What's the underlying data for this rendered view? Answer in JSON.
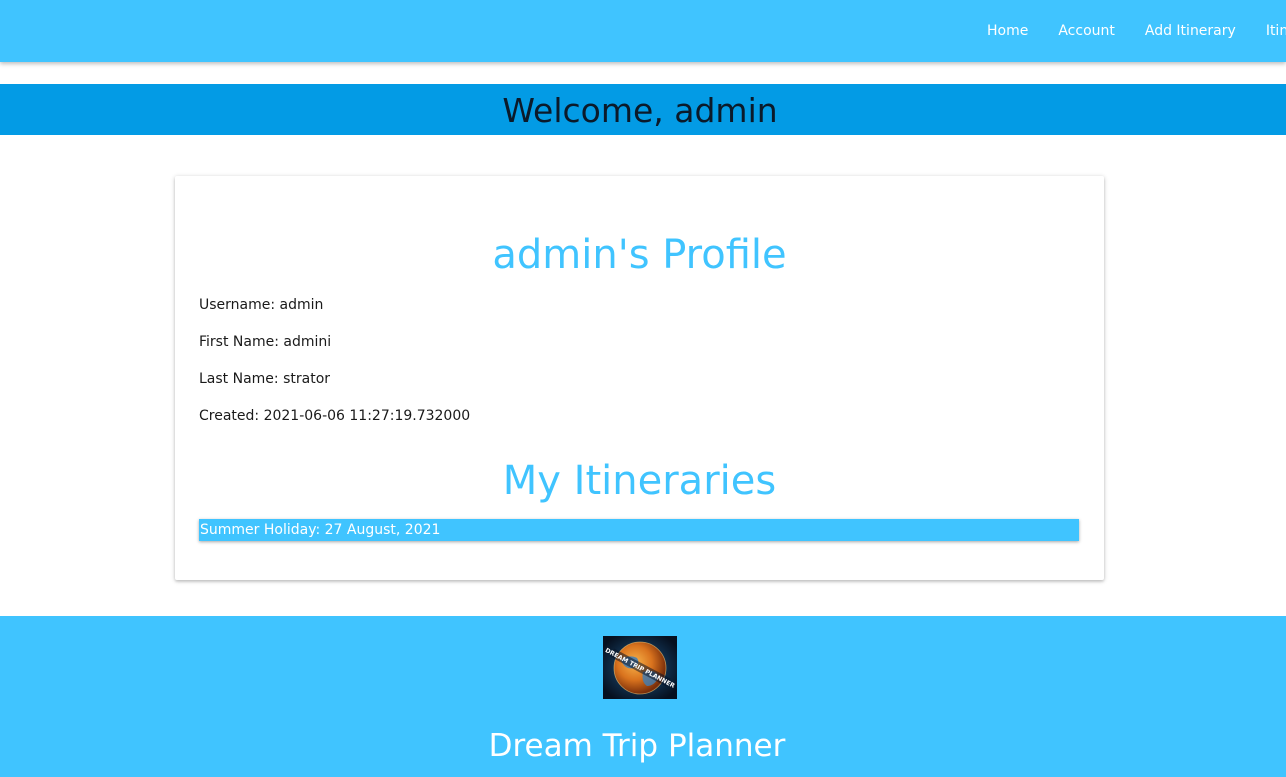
{
  "nav": {
    "links": [
      "Home",
      "Account",
      "Add Itinerary",
      "Itineraries"
    ]
  },
  "welcome": {
    "text": "Welcome, admin"
  },
  "profile": {
    "title": "admin's Profile",
    "username": "Username: admin",
    "first_name": "First Name: admini",
    "last_name": "Last Name: strator",
    "created": "Created: 2021-06-06 11:27:19.732000"
  },
  "itineraries": {
    "title": "My Itineraries",
    "items": [
      "Summer Holiday: 27 August, 2021"
    ]
  },
  "footer": {
    "logo_text": "DREAM TRIP PLANNER",
    "title": "Dream Trip Planner"
  },
  "colors": {
    "primary": "#40c4ff",
    "welcome_bar": "#039be5",
    "text_dark": "#0b1a2a"
  }
}
